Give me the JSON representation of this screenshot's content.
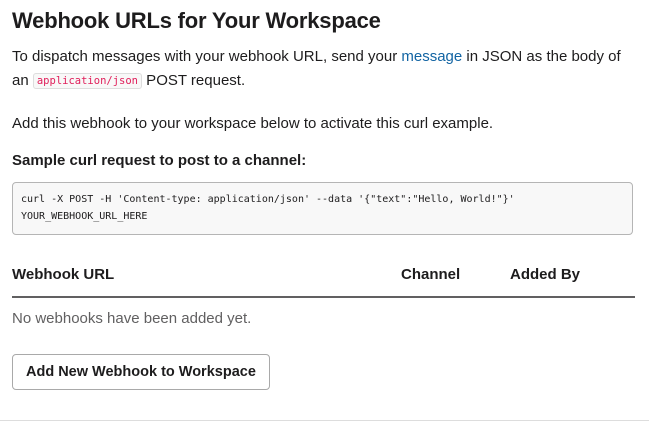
{
  "header": {
    "title": "Webhook URLs for Your Workspace"
  },
  "intro": {
    "before_link": "To dispatch messages with your webhook URL, send your ",
    "link_text": "message",
    "after_link": " in JSON as the body of an ",
    "inline_code": "application/json",
    "after_code": " POST request."
  },
  "activate_text": "Add this webhook to your workspace below to activate this curl example.",
  "sample": {
    "label": "Sample curl request to post to a channel:",
    "code_line1": "curl -X POST -H 'Content-type: application/json' --data '{\"text\":\"Hello, World!\"}'",
    "code_line2": "YOUR_WEBHOOK_URL_HERE"
  },
  "table": {
    "columns": [
      "Webhook URL",
      "Channel",
      "Added By"
    ],
    "empty_message": "No webhooks have been added yet."
  },
  "actions": {
    "add_button_label": "Add New Webhook to Workspace"
  },
  "colors": {
    "text": "#1d1c1d",
    "link": "#1264a3",
    "inline_code": "#e01e5a",
    "muted": "#616061"
  }
}
